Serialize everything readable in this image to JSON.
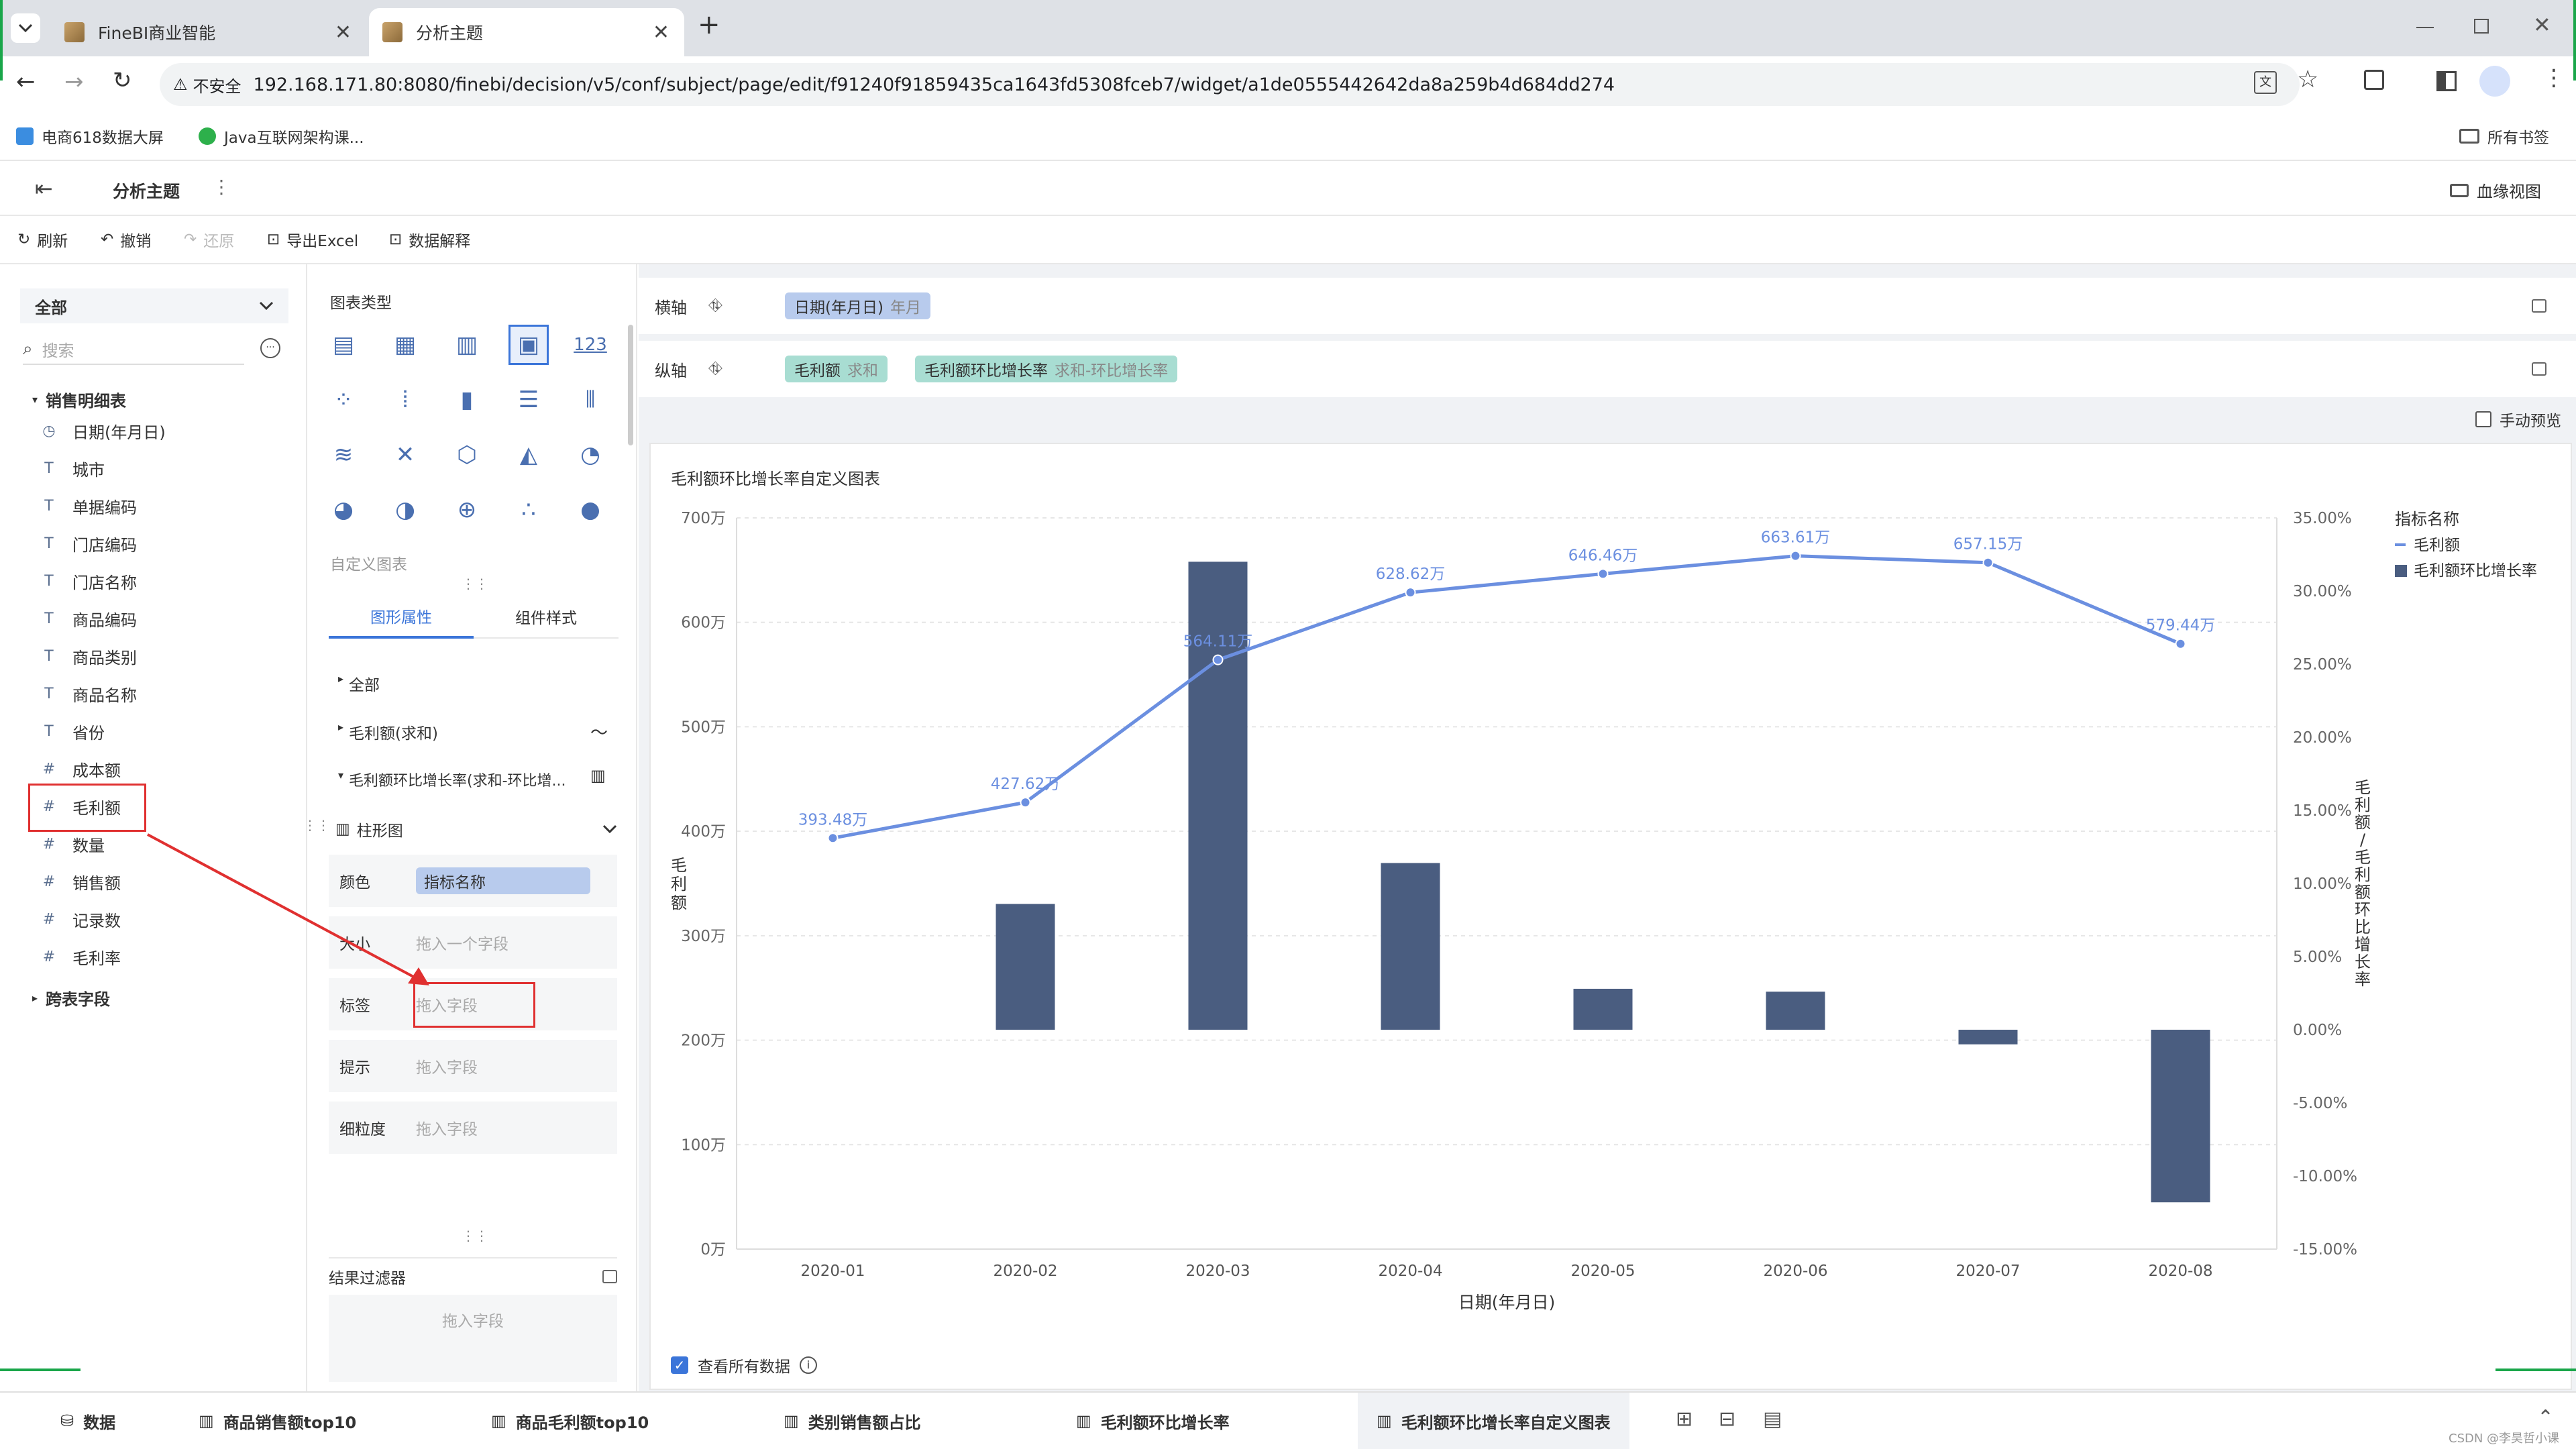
{
  "browser": {
    "tabs": [
      {
        "title": "FineBI商业智能"
      },
      {
        "title": "分析主题"
      }
    ],
    "new_tab_glyph": "+",
    "security_label": "不安全",
    "url": "192.168.171.80:8080/finebi/decision/v5/conf/subject/page/edit/f91240f91859435ca1643fd5308fceb7/widget/a1de0555442642da8a259b4d684dd274",
    "bookmarks": [
      "电商618数据大屏",
      "Java互联网架构课..."
    ],
    "all_bookmarks": "所有书签"
  },
  "app": {
    "title": "分析主题",
    "more_glyph": "⋮",
    "lineage_view": "血缘视图"
  },
  "toolbar": {
    "refresh": "刷新",
    "undo": "撤销",
    "redo": "还原",
    "export_excel": "导出Excel",
    "data_explain": "数据解释"
  },
  "left": {
    "scope": "全部",
    "search_placeholder": "搜索",
    "table_name": "销售明细表",
    "fields": [
      {
        "type": "date",
        "name": "日期(年月日)"
      },
      {
        "type": "T",
        "name": "城市"
      },
      {
        "type": "T",
        "name": "单据编码"
      },
      {
        "type": "T",
        "name": "门店编码"
      },
      {
        "type": "T",
        "name": "门店名称"
      },
      {
        "type": "T",
        "name": "商品编码"
      },
      {
        "type": "T",
        "name": "商品类别"
      },
      {
        "type": "T",
        "name": "商品名称"
      },
      {
        "type": "T",
        "name": "省份"
      },
      {
        "type": "#",
        "name": "成本额"
      },
      {
        "type": "#",
        "name": "毛利额"
      },
      {
        "type": "#",
        "name": "数量"
      },
      {
        "type": "#",
        "name": "销售额"
      },
      {
        "type": "#",
        "name": "记录数"
      },
      {
        "type": "#",
        "name": "毛利率"
      }
    ],
    "cross_table": "跨表字段"
  },
  "middle": {
    "chart_type_label": "图表类型",
    "custom_chart": "自定义图表",
    "tabs": [
      "图形属性",
      "组件样式"
    ],
    "tree": [
      "全部",
      "毛利额(求和)",
      "毛利额环比增长率(求和-环比增..."
    ],
    "mark_type": "柱形图",
    "props": [
      {
        "label": "颜色",
        "value": "指标名称"
      },
      {
        "label": "大小",
        "value": "拖入一个字段"
      },
      {
        "label": "标签",
        "value": "拖入字段"
      },
      {
        "label": "提示",
        "value": "拖入字段"
      },
      {
        "label": "细粒度",
        "value": "拖入字段"
      }
    ],
    "result_filter": "结果过滤器",
    "filter_placeholder": "拖入字段",
    "number_glyph": "123"
  },
  "axes": {
    "x_label": "横轴",
    "y_label": "纵轴",
    "x_pill": {
      "name": "日期(年月日)",
      "sub": "年月"
    },
    "y_pills": [
      {
        "name": "毛利额",
        "sub": "求和"
      },
      {
        "name": "毛利额环比增长率",
        "sub": "求和-环比增长率"
      }
    ],
    "manual_preview": "手动预览"
  },
  "chart_data": {
    "type": "bar+line",
    "title": "毛利额环比增长率自定义图表",
    "categories": [
      "2020-01",
      "2020-02",
      "2020-03",
      "2020-04",
      "2020-05",
      "2020-06",
      "2020-07",
      "2020-08"
    ],
    "xlabel": "日期(年月日)",
    "ylabel_left": "毛利额",
    "ylabel_right": "毛利额/毛利额环比增长率",
    "left_ticks": [
      "0万",
      "100万",
      "200万",
      "300万",
      "400万",
      "500万",
      "600万",
      "700万"
    ],
    "left_ylim": [
      0,
      700
    ],
    "right_ticks": [
      "-15.00%",
      "-10.00%",
      "-5.00%",
      "0.00%",
      "5.00%",
      "10.00%",
      "15.00%",
      "20.00%",
      "25.00%",
      "30.00%",
      "35.00%"
    ],
    "right_ylim": [
      -15,
      35
    ],
    "series": [
      {
        "name": "毛利额",
        "kind": "line",
        "color": "#6b8fe0",
        "values": [
          393.48,
          427.62,
          564.11,
          628.62,
          646.46,
          663.61,
          657.15,
          579.44
        ],
        "labels": [
          "393.48万",
          "427.62万",
          "564.11万",
          "628.62万",
          "646.46万",
          "663.61万",
          "657.15万",
          "579.44万"
        ]
      },
      {
        "name": "毛利额环比增长率",
        "kind": "bar",
        "color": "#4a5d80",
        "values": [
          null,
          8.6,
          32.0,
          11.4,
          2.8,
          2.6,
          -1.0,
          -11.8
        ]
      }
    ],
    "legend_title": "指标名称",
    "legend_position": "right"
  },
  "view_all_data": "查看所有数据",
  "bottom_tabs": [
    {
      "label": "数据"
    },
    {
      "label": "商品销售额top10"
    },
    {
      "label": "商品毛利额top10"
    },
    {
      "label": "类别销售额占比"
    },
    {
      "label": "毛利额环比增长率"
    },
    {
      "label": "毛利额环比增长率自定义图表"
    }
  ],
  "watermark": "CSDN @李昊哲小课"
}
